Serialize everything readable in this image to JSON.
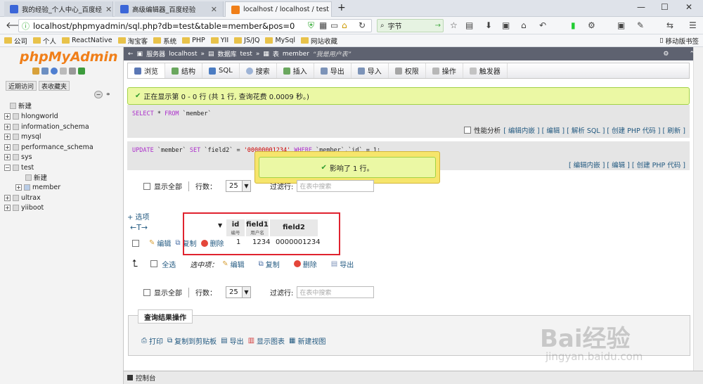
{
  "browser": {
    "tabs": [
      {
        "title": "我的经验_个人中心_百度经",
        "active": false
      },
      {
        "title": "高级编辑器_百度经验",
        "active": false
      },
      {
        "title": "localhost / localhost / test",
        "active": true
      }
    ],
    "new_tab": "+",
    "url": "localhost/phpmyadmin/sql.php?db=test&table=member&pos=0",
    "search_text": "字节",
    "win_controls": [
      "—",
      "☐",
      "✕"
    ]
  },
  "bookmarks": [
    "公司",
    "个人",
    "ReactNative",
    "淘宝客",
    "系统",
    "PHP",
    "YII",
    "JS/JQ",
    "MySql",
    "网站收藏"
  ],
  "bookmarks_right": "移动版书签",
  "left_panel": {
    "logo_php": "php",
    "logo_admin": "MyAdmin",
    "buttons": [
      "近期访问",
      "表收藏夹"
    ],
    "tree": [
      {
        "label": "新建",
        "level": 0
      },
      {
        "label": "hlongworld",
        "level": 0
      },
      {
        "label": "information_schema",
        "level": 0
      },
      {
        "label": "mysql",
        "level": 0
      },
      {
        "label": "performance_schema",
        "level": 0
      },
      {
        "label": "sys",
        "level": 0
      },
      {
        "label": "test",
        "level": 0
      },
      {
        "label": "新建",
        "level": 1
      },
      {
        "label": "member",
        "level": 1
      },
      {
        "label": "ultrax",
        "level": 0
      },
      {
        "label": "yiiboot",
        "level": 0
      }
    ]
  },
  "breadcrumb": {
    "server_label": "服务器",
    "server": "localhost",
    "db_label": "数据库",
    "db": "test",
    "table_label": "表",
    "table": "member",
    "comment": "“我是用户表”"
  },
  "tabs": [
    "浏览",
    "结构",
    "SQL",
    "搜索",
    "插入",
    "导出",
    "导入",
    "权限",
    "操作",
    "触发器"
  ],
  "result": {
    "success_msg": "正在显示第 0 - 0 行 (共 1 行, 查询花费 0.0009 秒。)",
    "select_sql": {
      "kw1": "SELECT",
      "rest1": " * ",
      "kw2": "FROM",
      "rest2": " `member`"
    },
    "select_opts": {
      "profiling": "性能分析",
      "links": "[ 编辑内嵌 ] [ 编辑 ] [ 解析 SQL ] [ 创建 PHP 代码 ] [ 刷新 ]"
    },
    "update_sql": {
      "kw1": "UPDATE",
      "rest1": " `member` ",
      "kw2": "SET",
      "rest2": " `field2` = ",
      "str": "'00000001234'",
      "kw3": "WHERE",
      "rest3": " `member`.`id` = 1;"
    },
    "update_opts": "[ 编辑内嵌 ] [ 编辑 ] [ 创建 PHP 代码 ]",
    "popup": "影响了 1 行。"
  },
  "controls": {
    "show_all": "显示全部",
    "rows_label": "行数：",
    "rows_value": "25",
    "filter_label": "过滤行:",
    "filter_placeholder": "在表中搜索",
    "options_link": "+ 选项",
    "arrows": "←T→"
  },
  "table": {
    "headers": [
      {
        "name": "id",
        "comment": "编号"
      },
      {
        "name": "field1",
        "comment": "用户名"
      },
      {
        "name": "field2",
        "comment": ""
      }
    ],
    "row_actions": [
      "编辑",
      "复制",
      "删除"
    ],
    "rows": [
      [
        "1",
        "1234",
        "0000001234"
      ]
    ]
  },
  "bulk": {
    "select_all": "全选",
    "with_selected": "选中项：",
    "actions": [
      "编辑",
      "复制",
      "删除",
      "导出"
    ]
  },
  "query_ops": {
    "title": "查询结果操作",
    "items": [
      "打印",
      "复制到剪贴板",
      "导出",
      "显示图表",
      "新建视图"
    ]
  },
  "console": "控制台",
  "watermark": {
    "main": "Bai经验",
    "sub": "jingyan.baidu.com"
  }
}
